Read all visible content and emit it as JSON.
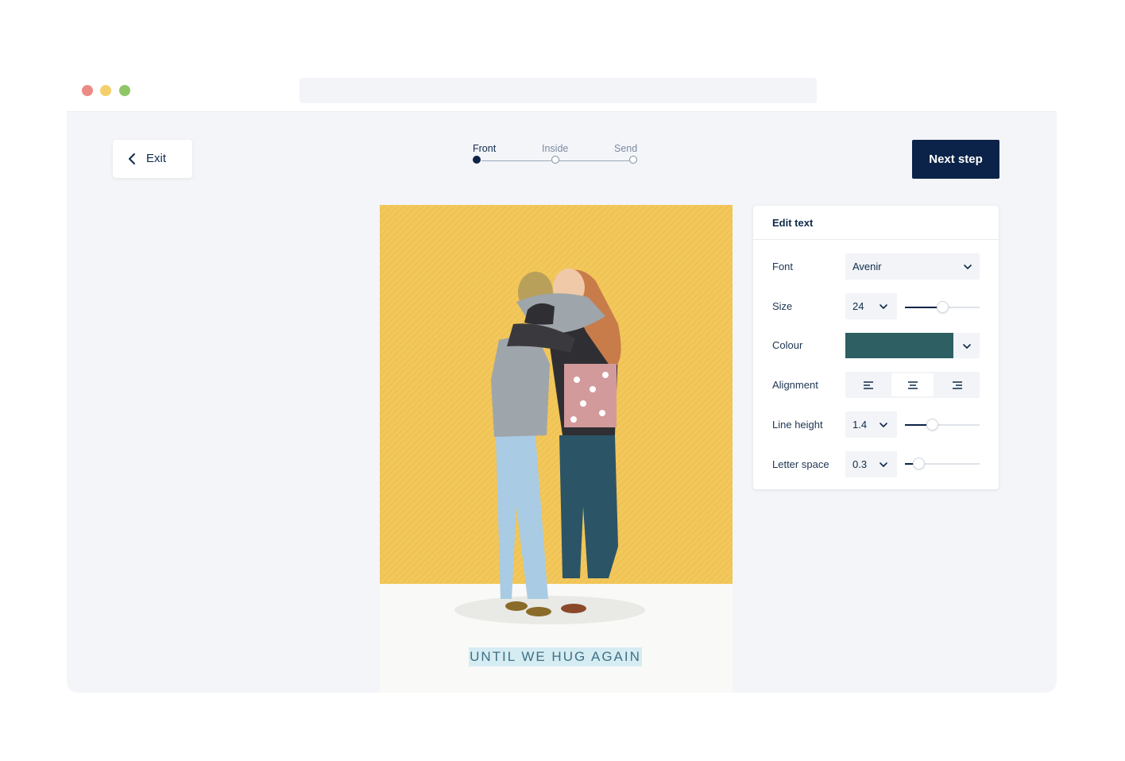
{
  "colors": {
    "navy": "#0b2348",
    "card_yellow": "#f2c75b",
    "selected_colour": "#2d5f63",
    "caption_highlight": "#d6ecf3"
  },
  "header": {
    "exit_label": "Exit",
    "next_label": "Next step",
    "steps": [
      {
        "label": "Front",
        "state": "current"
      },
      {
        "label": "Inside",
        "state": "upcoming"
      },
      {
        "label": "Send",
        "state": "upcoming"
      }
    ]
  },
  "card": {
    "caption": "UNTIL WE HUG AGAIN"
  },
  "panel": {
    "title": "Edit text",
    "font": {
      "label": "Font",
      "value": "Avenir"
    },
    "size": {
      "label": "Size",
      "value": "24",
      "slider_fraction": 0.5
    },
    "colour": {
      "label": "Colour"
    },
    "alignment": {
      "label": "Alignment",
      "selected": "center",
      "options": [
        "left-align-icon",
        "center-align-icon",
        "right-align-icon"
      ]
    },
    "line_height": {
      "label": "Line height",
      "value": "1.4",
      "slider_fraction": 0.36
    },
    "letter_space": {
      "label": "Letter space",
      "value": "0.3",
      "slider_fraction": 0.18
    }
  }
}
